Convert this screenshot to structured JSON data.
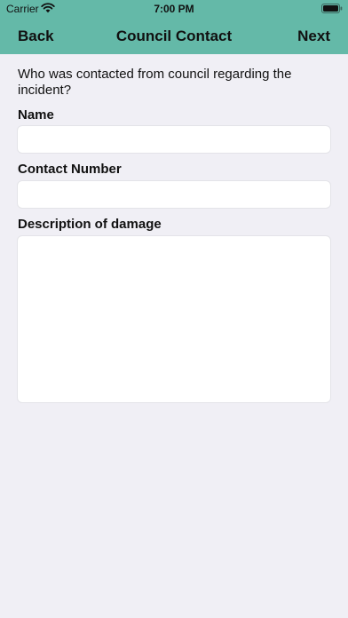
{
  "status_bar": {
    "carrier": "Carrier",
    "time": "7:00 PM",
    "wifi_icon": "wifi-icon",
    "battery_icon": "battery-icon"
  },
  "nav": {
    "back_label": "Back",
    "title": "Council Contact",
    "next_label": "Next"
  },
  "form": {
    "intro": "Who was contacted from council regarding the incident?",
    "name_label": "Name",
    "name_value": "",
    "contact_label": "Contact Number",
    "contact_value": "",
    "description_label": "Description of damage",
    "description_value": ""
  },
  "colors": {
    "header": "#64b9a8",
    "background": "#f0eff5",
    "field": "#ffffff"
  }
}
